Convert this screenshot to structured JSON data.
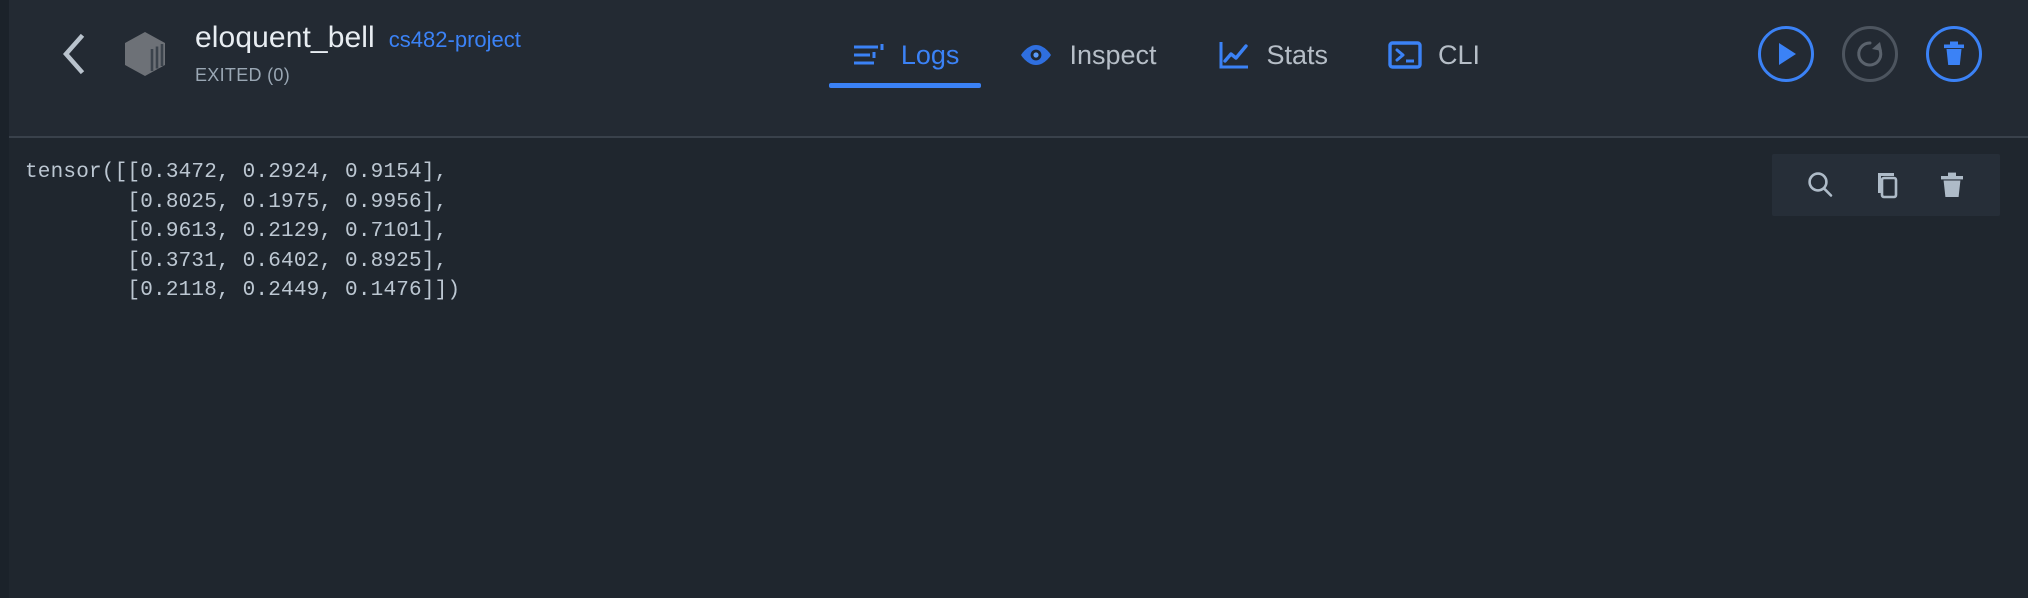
{
  "window": {
    "app": "container-logs-view"
  },
  "header": {
    "back_label": "Back",
    "container_icon": "cube-icon",
    "container_name": "eloquent_bell",
    "project_name": "cs482-project",
    "status": "EXITED (0)",
    "accent_color": "#3b82f6",
    "title_color": "#e8edf2",
    "status_color": "#9aa7b4",
    "background_color": "#232a33"
  },
  "tabs": [
    {
      "id": "logs",
      "label": "Logs",
      "icon": "logs-icon",
      "active": true
    },
    {
      "id": "inspect",
      "label": "Inspect",
      "icon": "eye-icon",
      "active": false
    },
    {
      "id": "stats",
      "label": "Stats",
      "icon": "chart-icon",
      "active": false
    },
    {
      "id": "cli",
      "label": "CLI",
      "icon": "terminal-icon",
      "active": false
    }
  ],
  "actions": [
    {
      "id": "start",
      "icon": "play-icon",
      "label": "Start",
      "enabled": true
    },
    {
      "id": "restart",
      "icon": "restart-icon",
      "label": "Restart",
      "enabled": false
    },
    {
      "id": "delete",
      "icon": "trash-icon",
      "label": "Delete",
      "enabled": true
    }
  ],
  "log_toolbar": [
    {
      "id": "search",
      "icon": "search-icon",
      "label": "Search logs"
    },
    {
      "id": "copy",
      "icon": "copy-icon",
      "label": "Copy logs"
    },
    {
      "id": "clear",
      "icon": "trash-icon",
      "label": "Clear logs"
    }
  ],
  "logs": {
    "text": "tensor([[0.3472, 0.2924, 0.9154],\n        [0.8025, 0.1975, 0.9956],\n        [0.9613, 0.2129, 0.7101],\n        [0.3731, 0.6402, 0.8925],\n        [0.2118, 0.2449, 0.1476]])",
    "background_color": "#1f262e",
    "text_color": "#bcc7d2"
  }
}
